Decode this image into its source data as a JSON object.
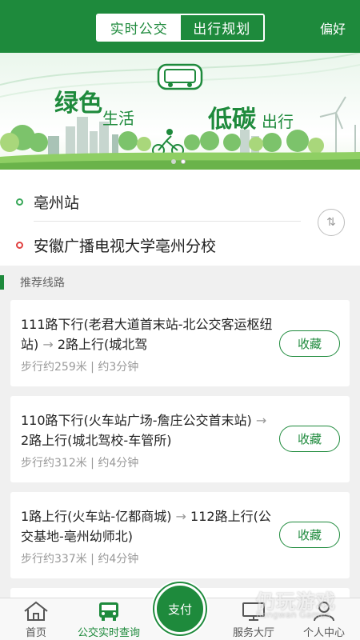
{
  "header": {
    "tabs": [
      {
        "label": "实时公交",
        "active": false
      },
      {
        "label": "出行规划",
        "active": true
      }
    ],
    "pref_label": "偏好"
  },
  "banner": {
    "text_green": "绿色",
    "text_life": "生活",
    "text_lowcarbon": "低碳",
    "text_travel": "出行",
    "bus_sign": "BUS",
    "page_count": 2,
    "active_page": 2
  },
  "route": {
    "origin": "亳州站",
    "destination": "安徽广播电视大学亳州分校",
    "swap_icon_glyph": "⇅"
  },
  "section": {
    "title": "推荐线路"
  },
  "routes": [
    {
      "leg1": "111路下行(老君大道首末站-北公交客运枢纽站)",
      "leg2": "2路上行(城北驾",
      "meta": "步行约259米 | 约3分钟",
      "fav_label": "收藏"
    },
    {
      "leg1": "110路下行(火车站广场-詹庄公交首末站)",
      "leg2": "2路上行(城北驾校-车管所)",
      "meta": "步行约312米 | 约4分钟",
      "fav_label": "收藏"
    },
    {
      "leg1": "1路上行(火车站-亿都商城)",
      "leg2": "112路上行(公交基地-亳州幼师北)",
      "meta": "步行约337米 | 约4分钟",
      "fav_label": "收藏"
    }
  ],
  "route_arrow": "→",
  "nav": {
    "items": [
      {
        "label": "首页",
        "icon": "home-icon",
        "active": false
      },
      {
        "label": "公交实时查询",
        "icon": "bus-icon",
        "active": true
      },
      {
        "label": "服务大厅",
        "icon": "monitor-icon",
        "active": false
      },
      {
        "label": "个人中心",
        "icon": "person-icon",
        "active": false
      }
    ],
    "pay_label": "支付"
  },
  "watermark": {
    "text": "仍玩游戏",
    "sub": "Rengwan Games"
  },
  "colors": {
    "brand_green": "#1e8a3c",
    "origin_dot": "#3aa85a",
    "destination_dot": "#e04040"
  }
}
